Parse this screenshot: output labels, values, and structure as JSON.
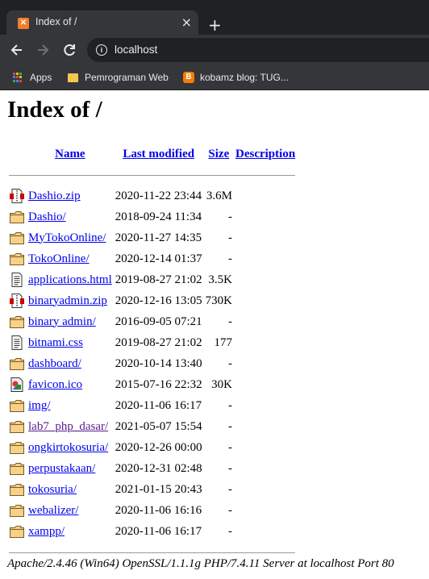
{
  "browser": {
    "tab_title": "Index of /",
    "tab_close": "×",
    "new_tab": "+",
    "url": "localhost",
    "bookmarks": [
      {
        "label": "Apps",
        "icon": "apps-grid-icon"
      },
      {
        "label": "Pemrograman Web",
        "icon": "folder-icon"
      },
      {
        "label": "kobamz blog: TUG...",
        "icon": "blogger-icon"
      }
    ]
  },
  "page": {
    "heading": "Index of /",
    "columns": {
      "name": "Name",
      "last_modified": "Last modified",
      "size": "Size",
      "description": "Description"
    },
    "rows": [
      {
        "icon": "compressed",
        "name": "Dashio.zip",
        "modified": "2020-11-22 23:44",
        "size": "3.6M",
        "visited": false
      },
      {
        "icon": "folder",
        "name": "Dashio/",
        "modified": "2018-09-24 11:34",
        "size": "-",
        "visited": false
      },
      {
        "icon": "folder",
        "name": "MyTokoOnline/",
        "modified": "2020-11-27 14:35",
        "size": "-",
        "visited": false
      },
      {
        "icon": "folder",
        "name": "TokoOnline/",
        "modified": "2020-12-14 01:37",
        "size": "-",
        "visited": false
      },
      {
        "icon": "text",
        "name": "applications.html",
        "modified": "2019-08-27 21:02",
        "size": "3.5K",
        "visited": false
      },
      {
        "icon": "compressed",
        "name": "binaryadmin.zip",
        "modified": "2020-12-16 13:05",
        "size": "730K",
        "visited": false
      },
      {
        "icon": "folder",
        "name": "binary admin/",
        "modified": "2016-09-05 07:21",
        "size": "-",
        "visited": false
      },
      {
        "icon": "text",
        "name": "bitnami.css",
        "modified": "2019-08-27 21:02",
        "size": "177",
        "visited": false
      },
      {
        "icon": "folder",
        "name": "dashboard/",
        "modified": "2020-10-14 13:40",
        "size": "-",
        "visited": false
      },
      {
        "icon": "image",
        "name": "favicon.ico",
        "modified": "2015-07-16 22:32",
        "size": "30K",
        "visited": false
      },
      {
        "icon": "folder",
        "name": "img/",
        "modified": "2020-11-06 16:17",
        "size": "-",
        "visited": false
      },
      {
        "icon": "folder",
        "name": "lab7_php_dasar/",
        "modified": "2021-05-07 15:54",
        "size": "-",
        "visited": true
      },
      {
        "icon": "folder",
        "name": "ongkirtokosuria/",
        "modified": "2020-12-26 00:00",
        "size": "-",
        "visited": false
      },
      {
        "icon": "folder",
        "name": "perpustakaan/",
        "modified": "2020-12-31 02:48",
        "size": "-",
        "visited": false
      },
      {
        "icon": "folder",
        "name": "tokosuria/",
        "modified": "2021-01-15 20:43",
        "size": "-",
        "visited": false
      },
      {
        "icon": "folder",
        "name": "webalizer/",
        "modified": "2020-11-06 16:16",
        "size": "-",
        "visited": false
      },
      {
        "icon": "folder",
        "name": "xampp/",
        "modified": "2020-11-06 16:17",
        "size": "-",
        "visited": false
      }
    ],
    "footer": "Apache/2.4.46 (Win64) OpenSSL/1.1.1g PHP/7.4.11 Server at localhost Port 80"
  },
  "colors": {
    "link": "#0000ee",
    "visited_link": "#551a8b",
    "chrome_dark": "#202124",
    "chrome_tab": "#35363a",
    "chrome_text": "#e8eaed"
  }
}
